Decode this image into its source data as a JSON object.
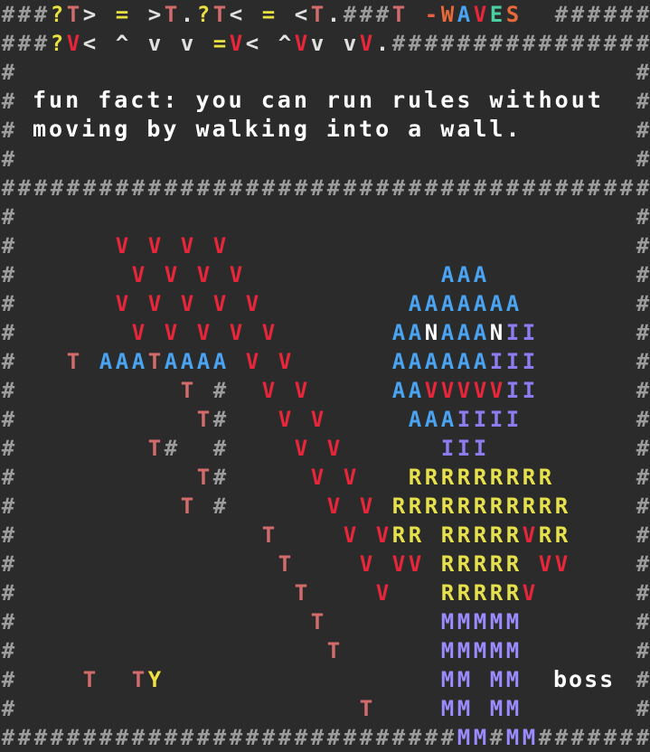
{
  "message": {
    "lines": [
      "fun fact: you can run rules without",
      "moving by walking into a wall."
    ]
  },
  "boss_label": "boss",
  "colors": {
    "background": "#2b2b2b",
    "#": "#9c9c9c",
    "V": "#e8263a",
    "A": "#4aa3f0",
    "I": "#8b7cf0",
    "N": "#ffffff",
    "R": "#e6e04a",
    "M": "#9a8cff",
    "T": "#d46b6b",
    "Y": "#f0e040",
    "?": "#e8e040",
    ">": "#e0e0e0",
    "<": "#e0e0e0",
    "=": "#e8e040",
    "^": "#e0e0e0",
    "v": "#e0e0e0",
    ".": "#e0e0e0",
    "-": "#e86040",
    "W": "#e86a3a",
    "E": "#4ad0a0",
    "S": "#e86a3a"
  },
  "map": [
    "###?T> = >T.?T< = <T.###T -WAVES  ######",
    "###?V< ^ v v =V< ^Vv vV.################",
    "#                                      #",
    "#                                      #",
    "#                                      #",
    "#                                      #",
    "########################################",
    "#                                      #",
    "#      V V V V                         #",
    "#       V V V V            AAA         #",
    "#      V V V V V         AAAAAAA       #",
    "#       V V V V V       AANAAANII      #",
    "#   T AAATAAAA V V      AAAAAAIII      #",
    "#          T #  V V     AAVVVVVII      #",
    "#           T#   V V     AAAIIII       #",
    "#        T#  #    V V      III         #",
    "#           T#     V V   RRRRRRRRR     #",
    "#          T #      V V RRRRRRRRRRR    #",
    "#               T    V VRR RRRRRVRR    #",
    "#                T    V VV RRRRR VV    #",
    "#                 T    V   RRRRRV      #",
    "#                  T       MMMMM       #",
    "#                   T      MMMMM       #",
    "#    T  TY                 MM MM       #",
    "#                     T    MM MM       #",
    "############################MM#MM#######"
  ]
}
